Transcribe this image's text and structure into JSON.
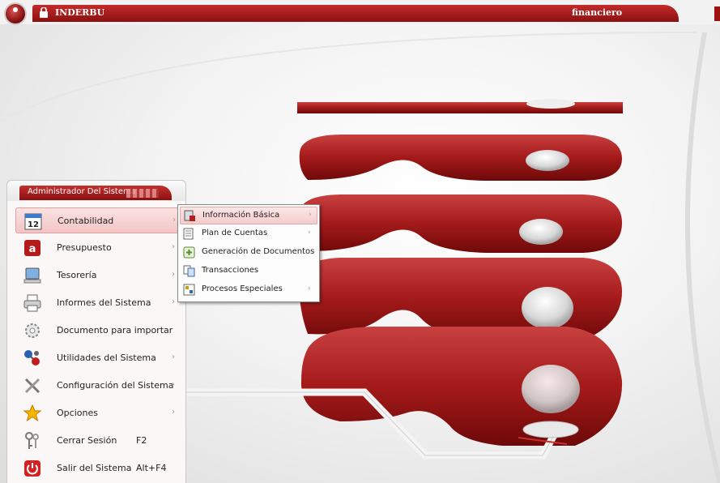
{
  "app": {
    "title": "INDERBU",
    "user": "financiero"
  },
  "panel": {
    "header": "Administrador Del Sistema"
  },
  "menu": [
    {
      "label": "Contabilidad",
      "icon": "calendar-12-icon",
      "icon_text": "12",
      "has_submenu": true,
      "active": true
    },
    {
      "label": "Presupuesto",
      "icon": "presupuesto-icon",
      "has_submenu": true
    },
    {
      "label": "Tesorería",
      "icon": "computer-icon",
      "has_submenu": true
    },
    {
      "label": "Informes del Sistema",
      "icon": "printer-icon",
      "has_submenu": true
    },
    {
      "label": "Documento para importar",
      "icon": "gear-icon",
      "has_submenu": false
    },
    {
      "label": "Utilidades del Sistema",
      "icon": "molecule-icon",
      "has_submenu": true
    },
    {
      "label": "Configuración del Sistema",
      "icon": "tools-icon",
      "has_submenu": true
    },
    {
      "label": "Opciones",
      "icon": "star-icon",
      "has_submenu": true
    },
    {
      "label": "Cerrar Sesión",
      "icon": "keys-icon",
      "shortcut": "F2",
      "has_submenu": false
    },
    {
      "label": "Salir del Sistema",
      "icon": "power-icon",
      "shortcut": "Alt+F4",
      "has_submenu": false
    }
  ],
  "submenu": [
    {
      "label": "Información Básica",
      "icon": "info-basica-icon",
      "has_submenu": true,
      "active": true
    },
    {
      "label": "Plan de Cuentas",
      "icon": "plan-cuentas-icon",
      "has_submenu": true
    },
    {
      "label": "Generación de Documentos",
      "icon": "generacion-icon",
      "has_submenu": false
    },
    {
      "label": "Transacciones",
      "icon": "transacciones-icon",
      "has_submenu": false
    },
    {
      "label": "Procesos Especiales",
      "icon": "procesos-icon",
      "has_submenu": true
    }
  ],
  "colors": {
    "accent": "#a01414",
    "accent_light": "#f4c8c8"
  }
}
